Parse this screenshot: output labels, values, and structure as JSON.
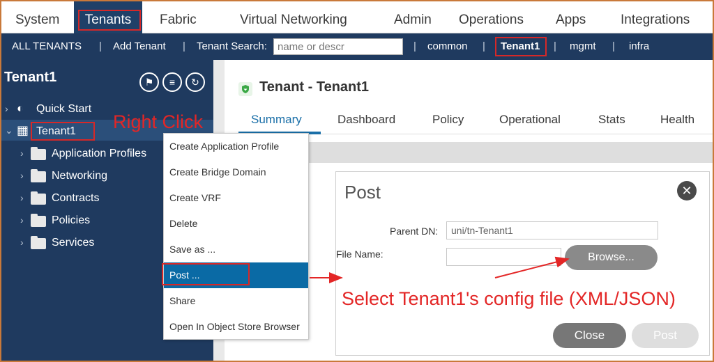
{
  "topnav": {
    "items": [
      "System",
      "Tenants",
      "Fabric",
      "Virtual Networking",
      "Admin",
      "Operations",
      "Apps",
      "Integrations"
    ],
    "active": "Tenants"
  },
  "subnav": {
    "all_tenants": "ALL TENANTS",
    "add_tenant": "Add Tenant",
    "search_label": "Tenant Search:",
    "search_placeholder": "name or descr",
    "links": [
      "common",
      "Tenant1",
      "mgmt",
      "infra"
    ]
  },
  "sidebar": {
    "title": "Tenant1",
    "quick_start": "Quick Start",
    "tenant": "Tenant1",
    "children": [
      "Application Profiles",
      "Networking",
      "Contracts",
      "Policies",
      "Services"
    ]
  },
  "annotations": {
    "right_click": "Right Click",
    "select_file": "Select Tenant1's config file (XML/JSON)",
    "color": "#e32626"
  },
  "context_menu": {
    "items": [
      "Create Application Profile",
      "Create Bridge Domain",
      "Create VRF",
      "Delete",
      "Save as ...",
      "Post ...",
      "Share",
      "Open In Object Store Browser"
    ],
    "selected": "Post ..."
  },
  "main": {
    "title": "Tenant - Tenant1",
    "tabs": [
      "Summary",
      "Dashboard",
      "Policy",
      "Operational",
      "Stats",
      "Health"
    ],
    "active_tab": "Summary"
  },
  "dialog": {
    "title": "Post",
    "parent_dn_label": "Parent DN:",
    "parent_dn_value": "uni/tn-Tenant1",
    "file_name_label": "File Name:",
    "browse": "Browse...",
    "close": "Close",
    "post": "Post"
  },
  "colors": {
    "nav_dark": "#1f3a5f",
    "accent_blue": "#0a6aa5",
    "highlight_red": "#d62828"
  }
}
